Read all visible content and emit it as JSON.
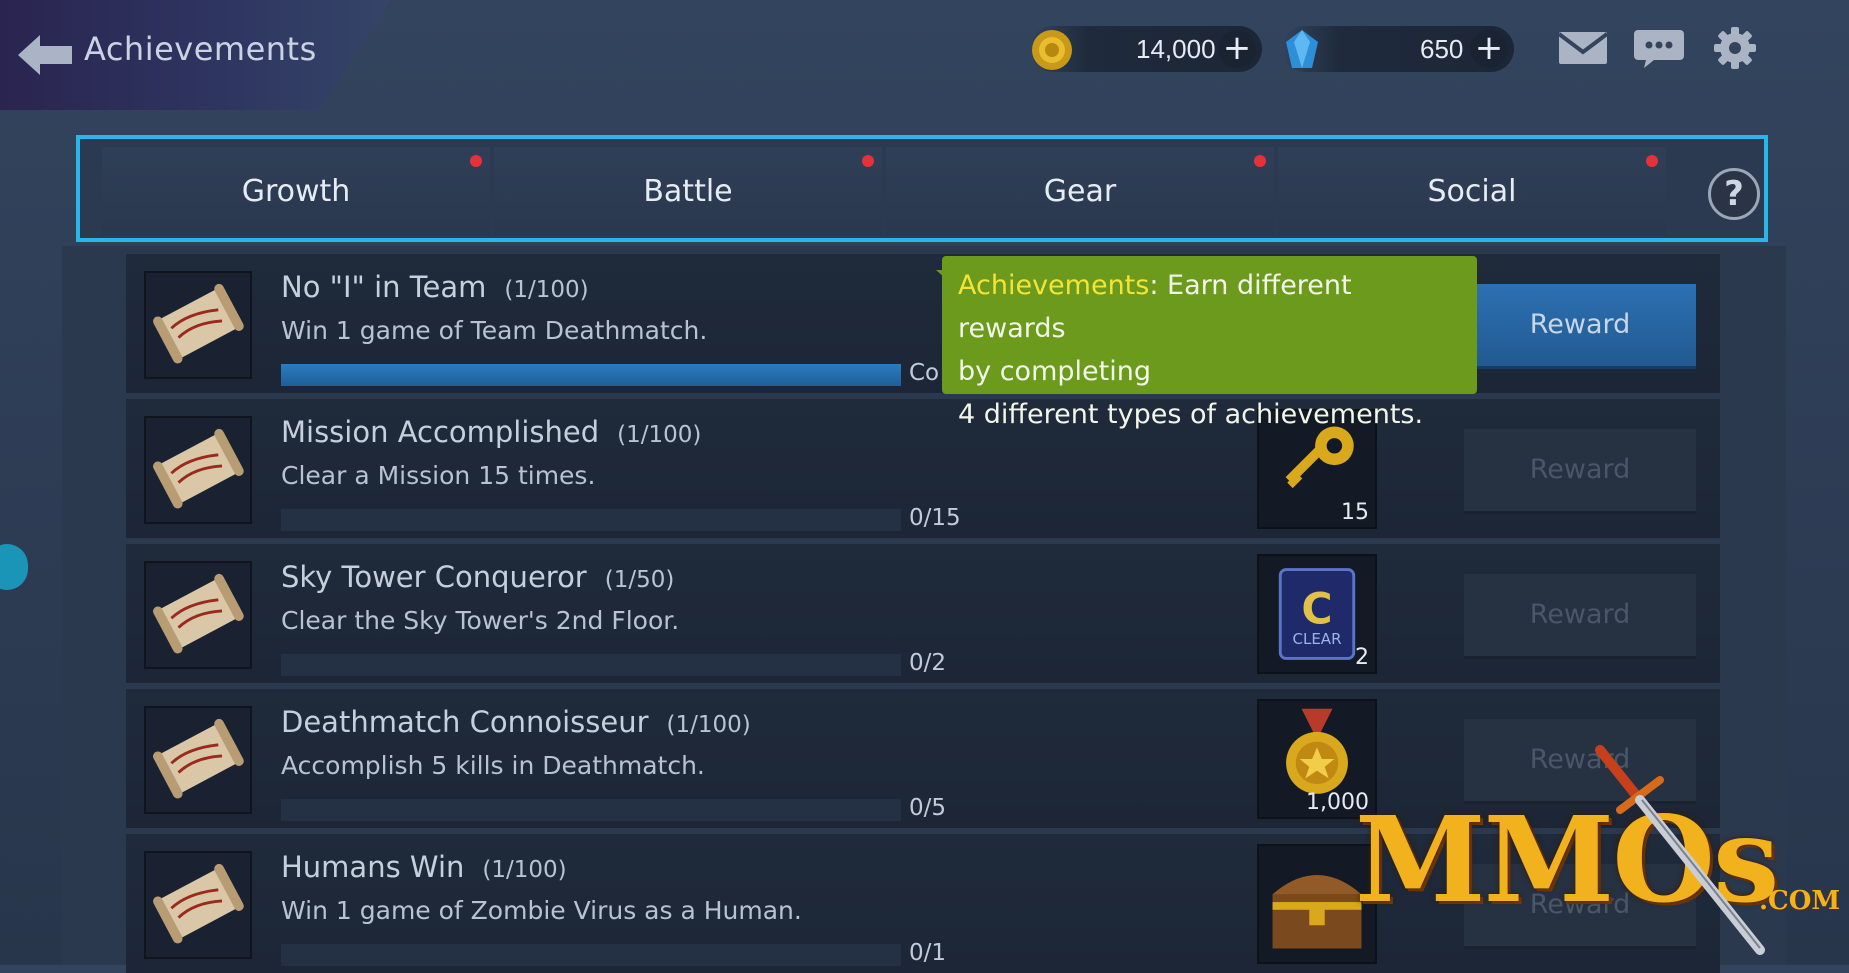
{
  "header": {
    "title": "Achievements",
    "gold_amount": "14,000",
    "gem_amount": "650",
    "plus_label": "+"
  },
  "tabs": [
    {
      "label": "Growth",
      "has_alert": true
    },
    {
      "label": "Battle",
      "has_alert": true
    },
    {
      "label": "Gear",
      "has_alert": true
    },
    {
      "label": "Social",
      "has_alert": true
    }
  ],
  "help_label": "?",
  "tooltip": {
    "keyword": "Achievements",
    "rest_line1": ": Earn different rewards",
    "line2": "by completing",
    "line3": "4 different types of achievements."
  },
  "achievements": [
    {
      "name": "No \"I\" in Team",
      "count": "(1/100)",
      "desc": "Win 1 game of Team Deathmatch.",
      "progress": 1.0,
      "progress_text": "Co",
      "reward_qty": "",
      "reward_icon": "none",
      "button": "Reward",
      "active": true
    },
    {
      "name": "Mission Accomplished",
      "count": "(1/100)",
      "desc": "Clear a Mission 15 times.",
      "progress": 0.0,
      "progress_text": "0/15",
      "reward_qty": "15",
      "reward_icon": "key-icon",
      "button": "Reward",
      "active": false
    },
    {
      "name": "Sky Tower Conqueror",
      "count": "(1/50)",
      "desc": "Clear the Sky Tower's 2nd Floor.",
      "progress": 0.0,
      "progress_text": "0/2",
      "reward_qty": "2",
      "reward_icon": "clear-ticket-icon",
      "reward_icon_text": "CLEAR",
      "button": "Reward",
      "active": false
    },
    {
      "name": "Deathmatch Connoisseur",
      "count": "(1/100)",
      "desc": "Accomplish 5 kills in Deathmatch.",
      "progress": 0.0,
      "progress_text": "0/5",
      "reward_qty": "1,000",
      "reward_icon": "medal-icon",
      "button": "Reward",
      "active": false
    },
    {
      "name": "Humans Win",
      "count": "(1/100)",
      "desc": "Win 1 game of Zombie Virus as a Human.",
      "progress": 0.0,
      "progress_text": "0/1",
      "reward_qty": "",
      "reward_icon": "treasure-chest-icon",
      "button": "Reward",
      "active": false
    }
  ],
  "watermark": {
    "text": "MMOs",
    "suffix": ".COM"
  },
  "colors": {
    "accent_border": "#29b6e8",
    "tooltip_bg": "#6b9a1c",
    "alert_dot": "#e8303a",
    "progress_fill": "#2a7cc0"
  }
}
